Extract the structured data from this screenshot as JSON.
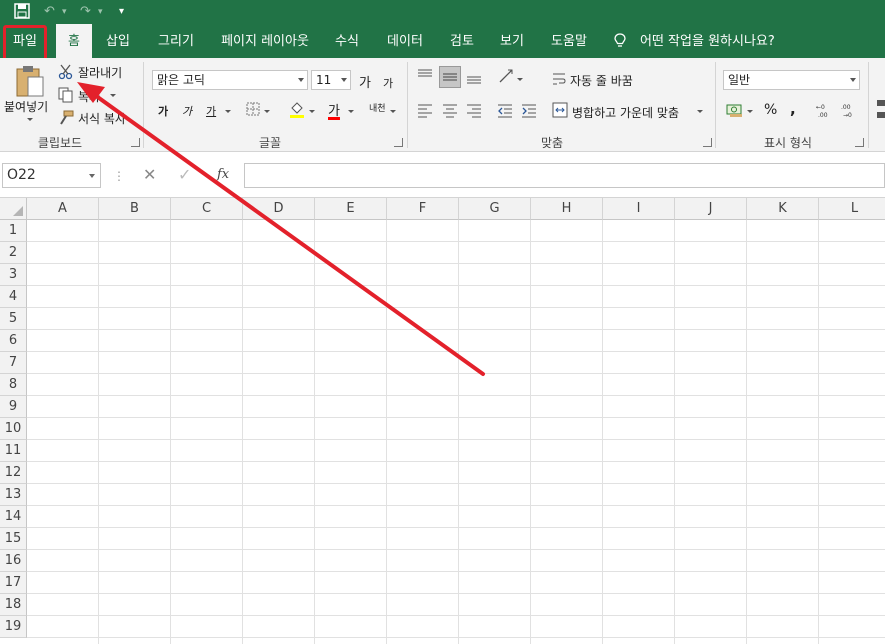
{
  "qat": {
    "save_icon": "save-icon",
    "undo_icon": "undo-icon",
    "redo_icon": "redo-icon",
    "customize_icon": "customize-qat-icon"
  },
  "tabs": [
    {
      "label": "파일"
    },
    {
      "label": "홈"
    },
    {
      "label": "삽입"
    },
    {
      "label": "그리기"
    },
    {
      "label": "페이지 레이아웃"
    },
    {
      "label": "수식"
    },
    {
      "label": "데이터"
    },
    {
      "label": "검토"
    },
    {
      "label": "보기"
    },
    {
      "label": "도움말"
    }
  ],
  "tell_me": {
    "icon": "lightbulb-icon",
    "label": "어떤 작업을 원하시나요?"
  },
  "clipboard": {
    "paste_label": "붙여넣기",
    "cut_label": "잘라내기",
    "copy_label": "복사",
    "format_painter_label": "서식 복사",
    "group_label": "클립보드"
  },
  "font": {
    "font_name": "맑은 고딕",
    "font_size": "11",
    "grow_label": "가",
    "shrink_label": "가",
    "bold_label": "가",
    "italic_label": "가",
    "underline_label": "가",
    "font_color_label": "가",
    "phonetic_label": "내천",
    "group_label": "글꼴",
    "colors": {
      "highlight": "#ffff00",
      "font_color": "#ff0000"
    }
  },
  "alignment": {
    "wrap_text_label": "자동 줄 바꿈",
    "merge_center_label": "병합하고 가운데 맞춤",
    "group_label": "맞춤"
  },
  "number": {
    "format_value": "일반",
    "percent_label": "%",
    "comma_label": ",",
    "group_label": "표시 형식"
  },
  "formula_bar": {
    "name_box": "O22",
    "cancel_icon": "cancel-icon",
    "enter_icon": "check-icon",
    "fx_label": "fx",
    "value": ""
  },
  "sheet": {
    "columns": [
      "A",
      "B",
      "C",
      "D",
      "E",
      "F",
      "G",
      "H",
      "I",
      "J",
      "K",
      "L"
    ],
    "rows": [
      "1",
      "2",
      "3",
      "4",
      "5",
      "6",
      "7",
      "8",
      "9",
      "10",
      "11",
      "12",
      "13",
      "14",
      "15",
      "16",
      "17",
      "18",
      "19"
    ]
  },
  "annotation": {
    "highlight_color": "#e3212b",
    "arrow_color": "#e3212b"
  }
}
